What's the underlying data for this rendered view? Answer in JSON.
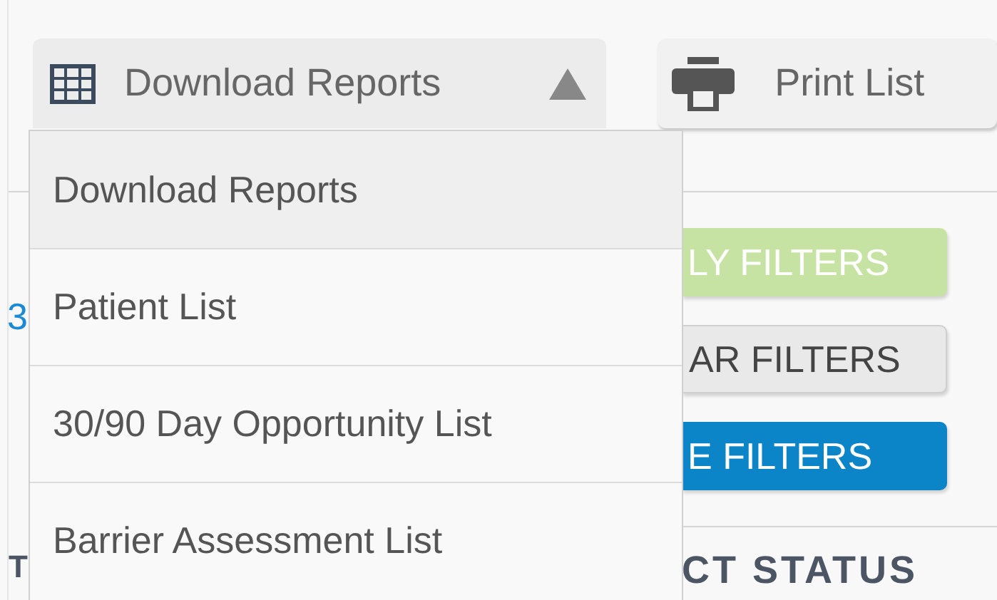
{
  "toolbar": {
    "download_button": {
      "label": "Download Reports",
      "expanded": true
    },
    "print_button": {
      "label": "Print List"
    }
  },
  "dropdown": {
    "items": [
      {
        "label": "Download Reports",
        "selected": true
      },
      {
        "label": "Patient List",
        "selected": false
      },
      {
        "label": "30/90 Day Opportunity List",
        "selected": false
      },
      {
        "label": "Barrier Assessment List",
        "selected": false
      }
    ]
  },
  "filter_buttons": [
    {
      "kind": "apply",
      "label": "LY FILTERS"
    },
    {
      "kind": "clear",
      "label": "AR FILTERS"
    },
    {
      "kind": "save",
      "label": "E FILTERS"
    }
  ],
  "left_link": "3",
  "left_column_header": "T",
  "column_header": "CT STATUS"
}
